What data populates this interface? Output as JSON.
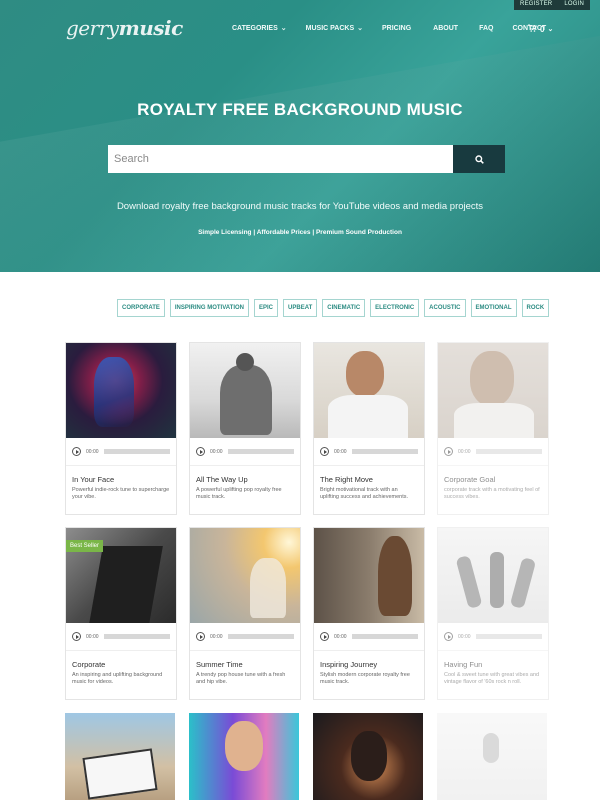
{
  "topbar": {
    "register": "REGISTER",
    "login": "LOGIN"
  },
  "logo": {
    "part1": "gerry",
    "part2": "music"
  },
  "nav": {
    "items": [
      {
        "label": "CATEGORIES",
        "dropdown": true
      },
      {
        "label": "MUSIC PACKS",
        "dropdown": true
      },
      {
        "label": "PRICING",
        "dropdown": false
      },
      {
        "label": "ABOUT",
        "dropdown": false
      },
      {
        "label": "FAQ",
        "dropdown": false
      },
      {
        "label": "CONTACT",
        "dropdown": false
      }
    ],
    "cart_count": "0"
  },
  "hero": {
    "title": "ROYALTY FREE BACKGROUND MUSIC",
    "search_placeholder": "Search",
    "subtitle": "Download royalty free background music tracks for YouTube videos and media projects",
    "tagline": "Simple Licensing | Affordable Prices | Premium Sound Production"
  },
  "genres": [
    "CORPORATE",
    "INSPIRING MOTIVATION",
    "EPIC",
    "UPBEAT",
    "CINEMATIC",
    "ELECTRONIC",
    "ACOUSTIC",
    "EMOTIONAL",
    "ROCK"
  ],
  "tracks": [
    {
      "title": "In Your Face",
      "desc": "Powerful indie-rock tune to supercharge your vibe.",
      "time": "00:00"
    },
    {
      "title": "All The Way Up",
      "desc": "A powerful uplifting pop royalty free music track.",
      "time": "00:00"
    },
    {
      "title": "The Right Move",
      "desc": "Bright motivational track with an uplifting success and achievements.",
      "time": "00:00"
    },
    {
      "title": "Corporate Goal",
      "desc": "corporate track with a motivating feel of success vibes.",
      "time": "00:00"
    },
    {
      "title": "Corporate",
      "desc": "An inspiring and uplifting background music for videos.",
      "time": "00:00",
      "badge": "Best Seller"
    },
    {
      "title": "Summer Time",
      "desc": "A trendy pop house tune with a fresh and hip vibe.",
      "time": "00:00"
    },
    {
      "title": "Inspiring Journey",
      "desc": "Stylish modern corporate royalty free music track.",
      "time": "00:00"
    },
    {
      "title": "Having Fun",
      "desc": "Cool & sweet tune with great vibes and vintage flavor of '60s rock n roll.",
      "time": "00:00"
    }
  ],
  "colors": {
    "accent": "#2b8b82",
    "hero": "#2f8c83",
    "search_button": "#183a3f",
    "badge": "#7ab648"
  }
}
